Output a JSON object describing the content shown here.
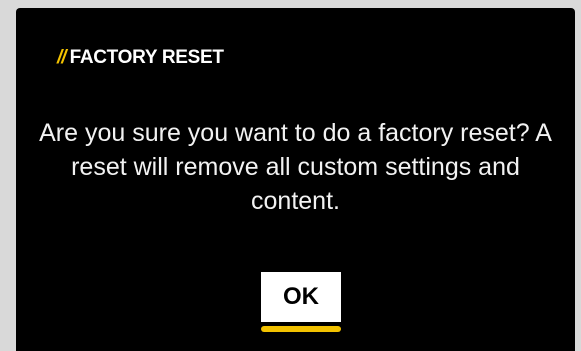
{
  "dialog": {
    "title_prefix": "//",
    "title": "FACTORY RESET",
    "message": "Are you sure you want to do a factory reset? A reset will remove all custom settings and content.",
    "ok_label": "OK"
  },
  "colors": {
    "accent": "#f2c200",
    "background": "#000000",
    "text": "#ffffff",
    "button_bg": "#ffffff"
  }
}
